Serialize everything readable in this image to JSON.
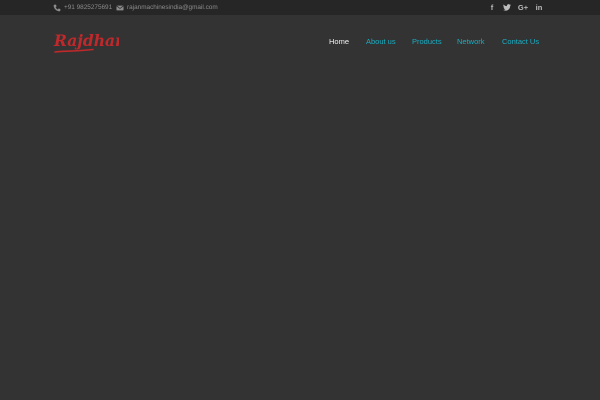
{
  "topbar": {
    "phone": "+91 9825275691",
    "email": "rajanmachinesindia@gmail.com",
    "phone_icon": "phone-icon",
    "email_icon": "envelope-icon",
    "social": [
      {
        "icon": "facebook-icon",
        "glyph": "f"
      },
      {
        "icon": "twitter-icon",
        "glyph": "t"
      },
      {
        "icon": "google-plus-icon",
        "glyph": "G+"
      },
      {
        "icon": "linkedin-icon",
        "glyph": "in"
      }
    ]
  },
  "brand": {
    "logo_text": "Rajdhani",
    "logo_color": "#c0282b"
  },
  "nav": {
    "items": [
      {
        "label": "Home",
        "active": true
      },
      {
        "label": "About us",
        "active": false
      },
      {
        "label": "Products",
        "active": false
      },
      {
        "label": "Network",
        "active": false
      },
      {
        "label": "Contact Us",
        "active": false
      }
    ]
  },
  "colors": {
    "background": "#333333",
    "topbar": "#262626",
    "accent": "#19aec4",
    "active_nav": "#f2f2f2"
  }
}
